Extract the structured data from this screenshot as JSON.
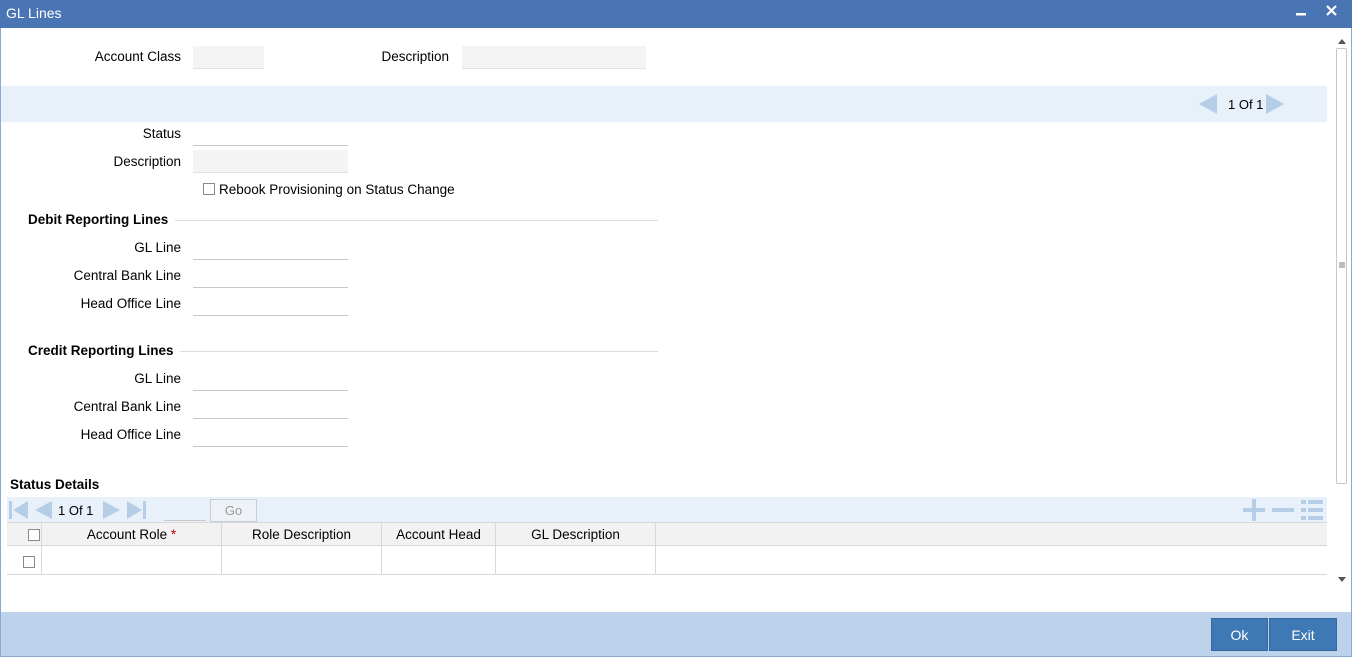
{
  "window": {
    "title": "GL Lines",
    "minimize_icon": "minimize-icon",
    "close_icon": "close-icon"
  },
  "header": {
    "account_class_label": "Account Class",
    "account_class_value": "",
    "description_label": "Description",
    "description_value": ""
  },
  "record_pager": {
    "text": "1 Of 1"
  },
  "status_block": {
    "status_label": "Status",
    "status_value": "",
    "description_label": "Description",
    "description_value": "",
    "rebook_label": "Rebook Provisioning on Status Change",
    "rebook_checked": false
  },
  "debit": {
    "title": "Debit Reporting Lines",
    "gl_line_label": "GL Line",
    "central_bank_label": "Central Bank Line",
    "head_office_label": "Head Office Line"
  },
  "credit": {
    "title": "Credit Reporting Lines",
    "gl_line_label": "GL Line",
    "central_bank_label": "Central Bank Line",
    "head_office_label": "Head Office Line"
  },
  "status_details": {
    "title": "Status Details",
    "pager_text": "1 Of 1",
    "go_label": "Go",
    "columns": [
      "Account Role",
      "Role Description",
      "Account Head",
      "GL Description"
    ],
    "required_mark": "*",
    "rows": [
      [
        "",
        "",
        "",
        ""
      ]
    ]
  },
  "footer": {
    "ok_label": "Ok",
    "exit_label": "Exit"
  },
  "colors": {
    "titlebar": "#4a75b4",
    "button": "#3e79b5",
    "footer": "#bdd3ec",
    "band": "#e8f0fa",
    "required": "#c00000"
  }
}
